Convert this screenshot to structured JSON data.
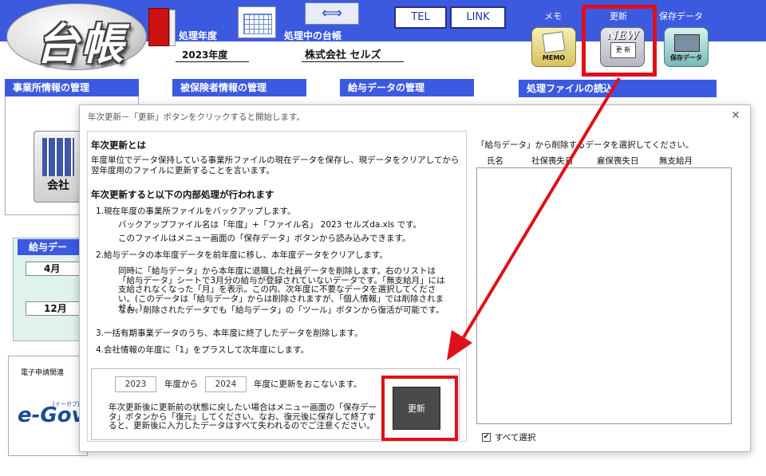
{
  "app": {
    "logo": "台帳",
    "fiscal_year_label": "処理年度",
    "fiscal_year_value": "2023年度",
    "ledger_label": "処理中の台帳",
    "ledger_value": "株式会社 セルズ",
    "tel_button": "TEL",
    "link_button": "LINK",
    "memo_label": "メモ",
    "memo_icon_text": "MEMO",
    "update_label": "更新",
    "update_icon_new": "NEW",
    "update_icon_text": "更 新",
    "save_label": "保存データ",
    "save_icon_text": "保存データ"
  },
  "sections": {
    "office": "事業所情報の管理",
    "insured": "被保険者情報の管理",
    "salary": "給与データの管理",
    "file_load": "処理ファイルの読込",
    "company_icon": "会社",
    "salary_panel": "給与デー",
    "month1": "4月",
    "month2": "12月",
    "egov_label": "電子申請関連",
    "egov_logo": "e-Gov",
    "egov_small": "[イーガブ]"
  },
  "dialog": {
    "title": "年次更新－「更新」ボタンをクリックすると開始します。",
    "heading1": "年次更新とは",
    "desc1": "年度単位でデータ保持している事業所ファイルの現在データを保存し、現データをクリアしてから",
    "desc2": "翌年度用のファイルに更新することを言います。",
    "heading2": "年次更新すると以下の内部処理が行われます",
    "s1": "1.現在年度の事業所ファイルをバックアップします。",
    "s1a": "バックアップファイル名は「年度」+「ファイル名」 2023 セルズda.xls です。",
    "s1b": "このファイルはメニュー画面の「保存データ」ボタンから読み込みできます。",
    "s2": "2.給与データの本年度データを前年度に移し、本年度データをクリアします。",
    "s2p": "同時に「給与データ」から本年度に退職した社員データを削除します。右のリストは「給与データ」シートで3月分の給与が登録されていないデータです。「無支給月」には支給されなくなった「月」を表示。この内、次年度に不要なデータを選択してください。(このデータは「給与データ」からは削除されますが、「個人情報」では削除されません。)",
    "s2q": "なお、削除されたデータでも「給与データ」の「ツール」ボタンから復活が可能です。",
    "s3": "3.一括有期事業データのうち、本年度に終了したデータを削除します。",
    "s4": "4.会社情報の年度に「1」をプラスして次年度にします。",
    "from_year": "2023",
    "from_suffix": "年度から",
    "to_year": "2024",
    "to_suffix": "年度に更新をおこないます。",
    "note": "年次更新後に更新前の状態に戻したい場合はメニュー画面の「保存データ」ボタンから「復元」してください。なお、復元後に保存して終了すると、更新後に入力したデータはすべて失われるのでご注意ください。",
    "update_button": "更新",
    "list_caption": "「給与データ」から削除するデータを選択してください。",
    "columns": [
      "氏名",
      "社保喪失日",
      "雇保喪失日",
      "無支給月"
    ],
    "select_all": "すべて選択",
    "select_all_checked": "✔"
  },
  "colors": {
    "header_blue": "#3c5ae0",
    "highlight_red": "#e0101a"
  }
}
